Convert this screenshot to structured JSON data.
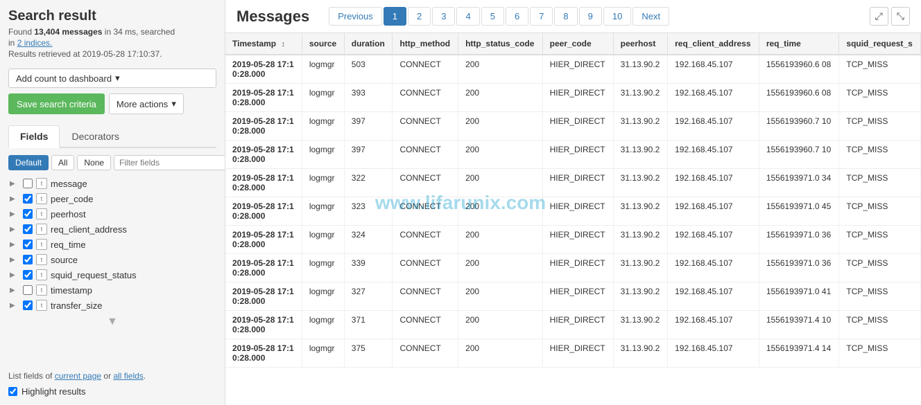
{
  "sidebar": {
    "title": "Search result",
    "found_prefix": "Found ",
    "found_count": "13,404 messages",
    "found_suffix": " in 34 ms, searched",
    "found_indices": "in 2 indices.",
    "retrieved": "Results retrieved at 2019-05-28 17:10:37.",
    "add_count_label": "Add count to dashboard",
    "save_label": "Save search criteria",
    "more_actions_label": "More actions",
    "tabs": [
      {
        "id": "fields",
        "label": "Fields",
        "active": true
      },
      {
        "id": "decorators",
        "label": "Decorators",
        "active": false
      }
    ],
    "filter_buttons": [
      {
        "id": "default",
        "label": "Default",
        "active": true
      },
      {
        "id": "all",
        "label": "All",
        "active": false
      },
      {
        "id": "none",
        "label": "None",
        "active": false
      }
    ],
    "filter_placeholder": "Filter fields",
    "fields": [
      {
        "name": "message",
        "checked": false,
        "type": "text"
      },
      {
        "name": "peer_code",
        "checked": true,
        "type": "text"
      },
      {
        "name": "peerhost",
        "checked": true,
        "type": "text"
      },
      {
        "name": "req_client_address",
        "checked": true,
        "type": "text"
      },
      {
        "name": "req_time",
        "checked": true,
        "type": "text"
      },
      {
        "name": "source",
        "checked": true,
        "type": "text"
      },
      {
        "name": "squid_request_status",
        "checked": true,
        "type": "text"
      },
      {
        "name": "timestamp",
        "checked": false,
        "type": "text"
      },
      {
        "name": "transfer_size",
        "checked": true,
        "type": "text"
      }
    ],
    "footer_current": "current page",
    "footer_all": "all fields",
    "footer_prefix": "List fields of ",
    "footer_or": " or ",
    "highlight_label": "Highlight results"
  },
  "main": {
    "title": "Messages",
    "pagination": {
      "previous": "Previous",
      "next": "Next",
      "pages": [
        "1",
        "2",
        "3",
        "4",
        "5",
        "6",
        "7",
        "8",
        "9",
        "10"
      ],
      "active_page": "1"
    },
    "table": {
      "columns": [
        {
          "id": "timestamp",
          "label": "Timestamp",
          "sort": true
        },
        {
          "id": "source",
          "label": "source"
        },
        {
          "id": "duration",
          "label": "duration"
        },
        {
          "id": "http_method",
          "label": "http_method"
        },
        {
          "id": "http_status_code",
          "label": "http_status_code"
        },
        {
          "id": "peer_code",
          "label": "peer_code"
        },
        {
          "id": "peerhost",
          "label": "peerhost"
        },
        {
          "id": "req_client_address",
          "label": "req_client_address"
        },
        {
          "id": "req_time",
          "label": "req_time"
        },
        {
          "id": "squid_request_s",
          "label": "squid_request_s"
        }
      ],
      "rows": [
        {
          "timestamp": "2019-05-28 17:1\n0:28.000",
          "source": "logmgr",
          "duration": "503",
          "http_method": "CONNECT",
          "http_status_code": "200",
          "peer_code": "HIER_DIRECT",
          "peerhost": "31.13.90.2",
          "req_client_address": "192.168.45.107",
          "req_time": "1556193960.6\n08",
          "squid_request_s": "TCP_MISS"
        },
        {
          "timestamp": "2019-05-28 17:1\n0:28.000",
          "source": "logmgr",
          "duration": "393",
          "http_method": "CONNECT",
          "http_status_code": "200",
          "peer_code": "HIER_DIRECT",
          "peerhost": "31.13.90.2",
          "req_client_address": "192.168.45.107",
          "req_time": "1556193960.6\n08",
          "squid_request_s": "TCP_MISS"
        },
        {
          "timestamp": "2019-05-28 17:1\n0:28.000",
          "source": "logmgr",
          "duration": "397",
          "http_method": "CONNECT",
          "http_status_code": "200",
          "peer_code": "HIER_DIRECT",
          "peerhost": "31.13.90.2",
          "req_client_address": "192.168.45.107",
          "req_time": "1556193960.7\n10",
          "squid_request_s": "TCP_MISS"
        },
        {
          "timestamp": "2019-05-28 17:1\n0:28.000",
          "source": "logmgr",
          "duration": "397",
          "http_method": "CONNECT",
          "http_status_code": "200",
          "peer_code": "HIER_DIRECT",
          "peerhost": "31.13.90.2",
          "req_client_address": "192.168.45.107",
          "req_time": "1556193960.7\n10",
          "squid_request_s": "TCP_MISS"
        },
        {
          "timestamp": "2019-05-28 17:1\n0:28.000",
          "source": "logmgr",
          "duration": "322",
          "http_method": "CONNECT",
          "http_status_code": "200",
          "peer_code": "HIER_DIRECT",
          "peerhost": "31.13.90.2",
          "req_client_address": "192.168.45.107",
          "req_time": "1556193971.0\n34",
          "squid_request_s": "TCP_MISS"
        },
        {
          "timestamp": "2019-05-28 17:1\n0:28.000",
          "source": "logmgr",
          "duration": "323",
          "http_method": "CONNECT",
          "http_status_code": "200",
          "peer_code": "HIER_DIRECT",
          "peerhost": "31.13.90.2",
          "req_client_address": "192.168.45.107",
          "req_time": "1556193971.0\n45",
          "squid_request_s": "TCP_MISS"
        },
        {
          "timestamp": "2019-05-28 17:1\n0:28.000",
          "source": "logmgr",
          "duration": "324",
          "http_method": "CONNECT",
          "http_status_code": "200",
          "peer_code": "HIER_DIRECT",
          "peerhost": "31.13.90.2",
          "req_client_address": "192.168.45.107",
          "req_time": "1556193971.0\n36",
          "squid_request_s": "TCP_MISS"
        },
        {
          "timestamp": "2019-05-28 17:1\n0:28.000",
          "source": "logmgr",
          "duration": "339",
          "http_method": "CONNECT",
          "http_status_code": "200",
          "peer_code": "HIER_DIRECT",
          "peerhost": "31.13.90.2",
          "req_client_address": "192.168.45.107",
          "req_time": "1556193971.0\n36",
          "squid_request_s": "TCP_MISS"
        },
        {
          "timestamp": "2019-05-28 17:1\n0:28.000",
          "source": "logmgr",
          "duration": "327",
          "http_method": "CONNECT",
          "http_status_code": "200",
          "peer_code": "HIER_DIRECT",
          "peerhost": "31.13.90.2",
          "req_client_address": "192.168.45.107",
          "req_time": "1556193971.0\n41",
          "squid_request_s": "TCP_MISS"
        },
        {
          "timestamp": "2019-05-28 17:1\n0:28.000",
          "source": "logmgr",
          "duration": "371",
          "http_method": "CONNECT",
          "http_status_code": "200",
          "peer_code": "HIER_DIRECT",
          "peerhost": "31.13.90.2",
          "req_client_address": "192.168.45.107",
          "req_time": "1556193971.4\n10",
          "squid_request_s": "TCP_MISS"
        },
        {
          "timestamp": "2019-05-28 17:1\n0:28.000",
          "source": "logmgr",
          "duration": "375",
          "http_method": "CONNECT",
          "http_status_code": "200",
          "peer_code": "HIER_DIRECT",
          "peerhost": "31.13.90.2",
          "req_client_address": "192.168.45.107",
          "req_time": "1556193971.4\n14",
          "squid_request_s": "TCP_MISS"
        }
      ]
    }
  }
}
